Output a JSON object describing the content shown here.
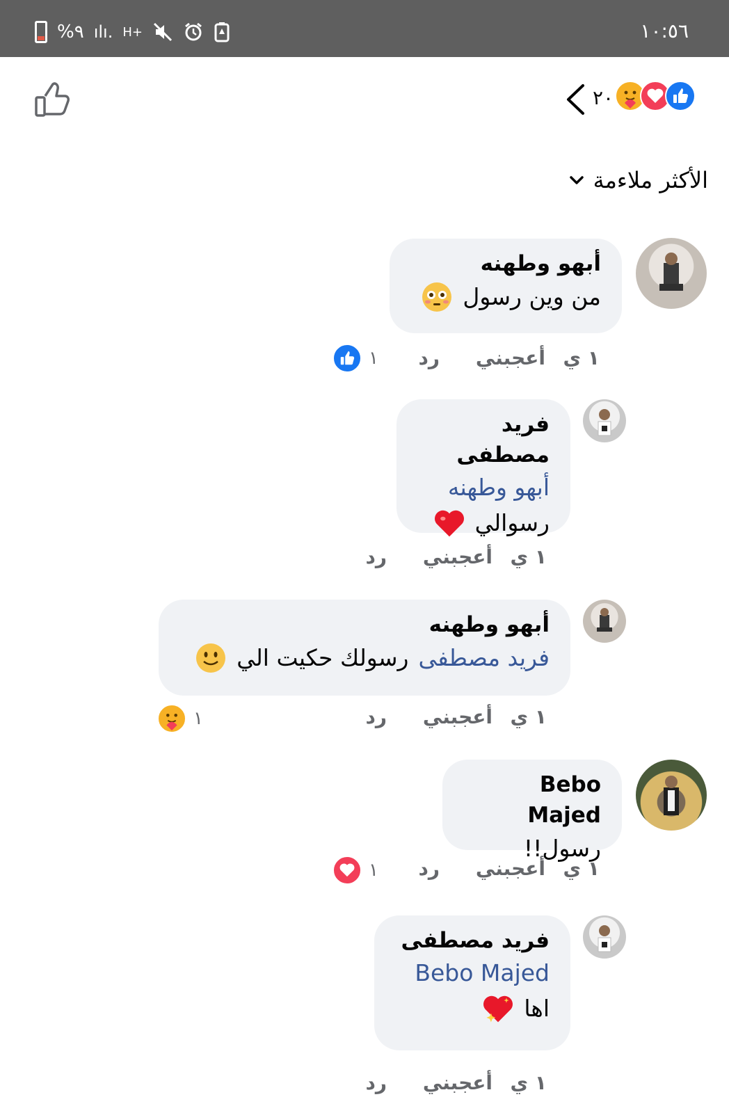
{
  "status_bar": {
    "battery_text": "%٩",
    "signal": "ılı.",
    "network": "H+",
    "time": "١٠:٥٦",
    "icons": [
      "battery-icon",
      "signal-icon",
      "data-network-icon",
      "mute-icon",
      "alarm-icon",
      "battery-saver-icon"
    ]
  },
  "header": {
    "reaction_count": "٢٠",
    "reactions": [
      "like-reaction",
      "love-reaction",
      "care-reaction"
    ],
    "sort_label": "الأكثر ملاءمة"
  },
  "comments": [
    {
      "author": "أبهو وطهنه",
      "text": "من وين رسول",
      "emoji": "flushed-face",
      "time": "١ ي",
      "like_label": "أعجبني",
      "reply_label": "رد",
      "reaction_count": "١",
      "reaction": "like"
    },
    {
      "author": "فريد مصطفى",
      "mention": "أبهو وطهنه",
      "text": "رسوالي",
      "emoji": "red-heart",
      "time": "١ ي",
      "like_label": "أعجبني",
      "reply_label": "رد"
    },
    {
      "author": "أبهو وطهنه",
      "mention": "فريد مصطفى",
      "text": "رسولك حكيت الي",
      "emoji": "slightly-smiling-face",
      "time": "١ ي",
      "like_label": "أعجبني",
      "reply_label": "رد",
      "reaction_count": "١",
      "reaction": "care"
    },
    {
      "author": "Bebo Majed",
      "text": "رسول!!",
      "time": "١ ي",
      "like_label": "أعجبني",
      "reply_label": "رد",
      "reaction_count": "١",
      "reaction": "love"
    },
    {
      "author": "فريد مصطفى",
      "mention": "Bebo Majed",
      "text": "اها",
      "emoji": "sparkling-heart",
      "time": "١ ي",
      "like_label": "أعجبني",
      "reply_label": "رد"
    }
  ],
  "colors": {
    "status_bar": "#5f5f5f",
    "bubble": "#f0f2f5",
    "mention": "#385898",
    "meta": "#65676b",
    "like": "#1877f2",
    "love": "#f33e58",
    "care": "#f7b125"
  }
}
